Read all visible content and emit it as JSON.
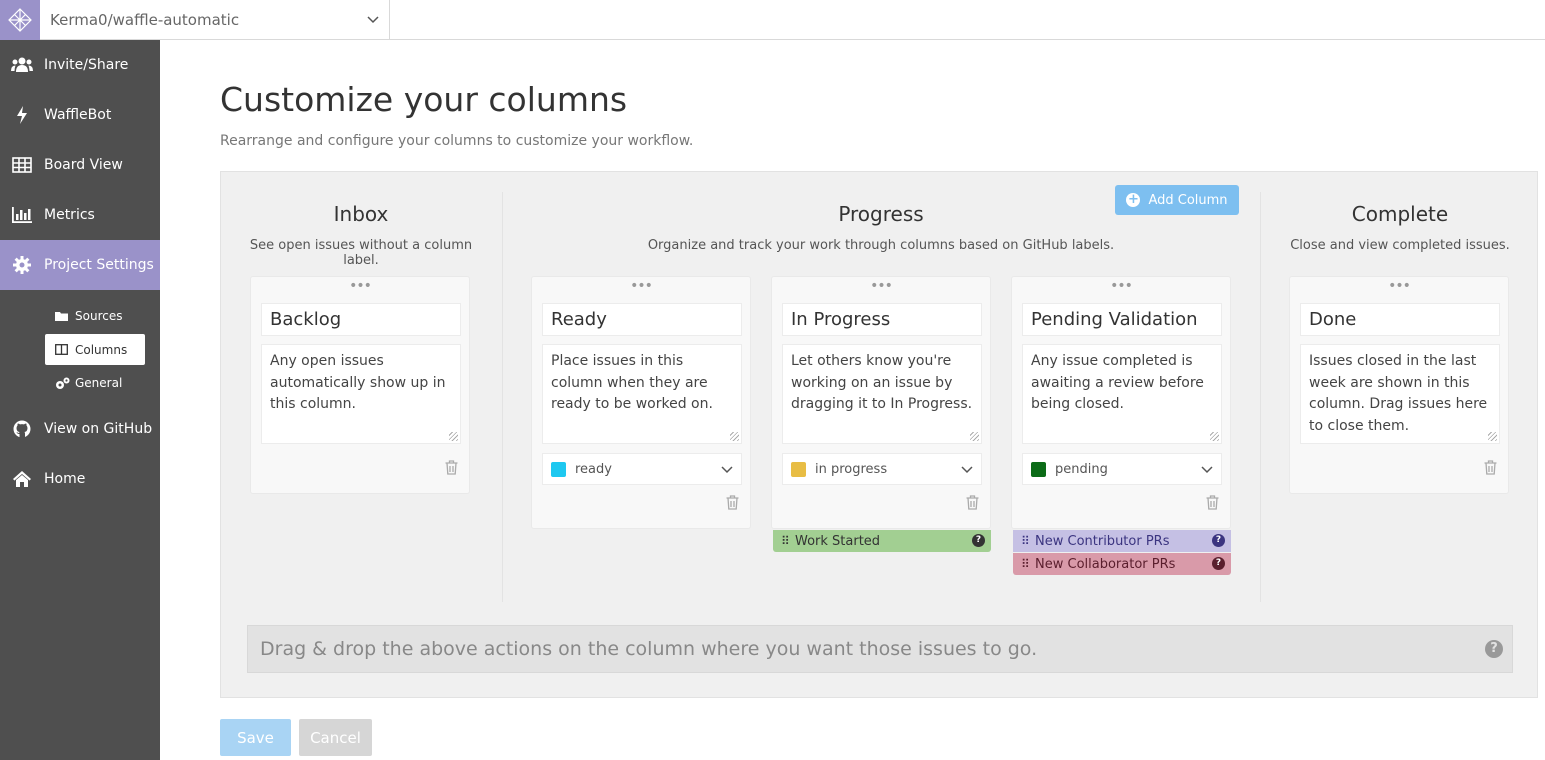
{
  "header": {
    "repo": "Kerma0/waffle-automatic"
  },
  "sidebar": {
    "items": [
      {
        "label": "Invite/Share",
        "icon": "users-icon"
      },
      {
        "label": "WaffleBot",
        "icon": "bolt-icon"
      },
      {
        "label": "Board View",
        "icon": "table-icon"
      },
      {
        "label": "Metrics",
        "icon": "bar-chart-icon"
      },
      {
        "label": "Project Settings",
        "icon": "gear-icon"
      }
    ],
    "subitems": [
      {
        "label": "Sources",
        "icon": "folder-icon"
      },
      {
        "label": "Columns",
        "icon": "columns-icon"
      },
      {
        "label": "General",
        "icon": "gears-icon"
      }
    ],
    "bottom": [
      {
        "label": "View on GitHub",
        "icon": "github-icon"
      },
      {
        "label": "Home",
        "icon": "home-icon"
      }
    ]
  },
  "page": {
    "title": "Customize your columns",
    "subtitle": "Rearrange and configure your columns to customize your workflow."
  },
  "groups": {
    "inbox": {
      "title": "Inbox",
      "desc": "See open issues without a column label."
    },
    "progress": {
      "title": "Progress",
      "desc": "Organize and track your work through columns based on GitHub labels."
    },
    "complete": {
      "title": "Complete",
      "desc": "Close and view completed issues."
    }
  },
  "add_column": "Add Column",
  "columns": [
    {
      "name": "Backlog",
      "desc": "Any open issues automatically show up in this column."
    },
    {
      "name": "Ready",
      "desc": "Place issues in this column when they are ready to be worked on.",
      "label": "ready",
      "color": "#1ec8f0"
    },
    {
      "name": "In Progress",
      "desc": "Let others know you're working on an issue by dragging it to In Progress.",
      "label": "in progress",
      "color": "#e8bd44"
    },
    {
      "name": "Pending Validation",
      "desc": "Any issue completed is awaiting a review before being closed.",
      "label": "pending",
      "color": "#0b6b17"
    },
    {
      "name": "Done",
      "desc": "Issues closed in the last week are shown in this column. Drag issues here to close them."
    }
  ],
  "actions": {
    "work_started": {
      "label": "Work Started",
      "color": "#a2cf92"
    },
    "new_contributor": {
      "label": "New Contributor PRs",
      "color": "#c5c0e4"
    },
    "new_collaborator": {
      "label": "New Collaborator PRs",
      "color": "#d99aa9"
    }
  },
  "dropzone": "Drag & drop the above actions on the column where you want those issues to go.",
  "buttons": {
    "save": "Save",
    "cancel": "Cancel"
  }
}
